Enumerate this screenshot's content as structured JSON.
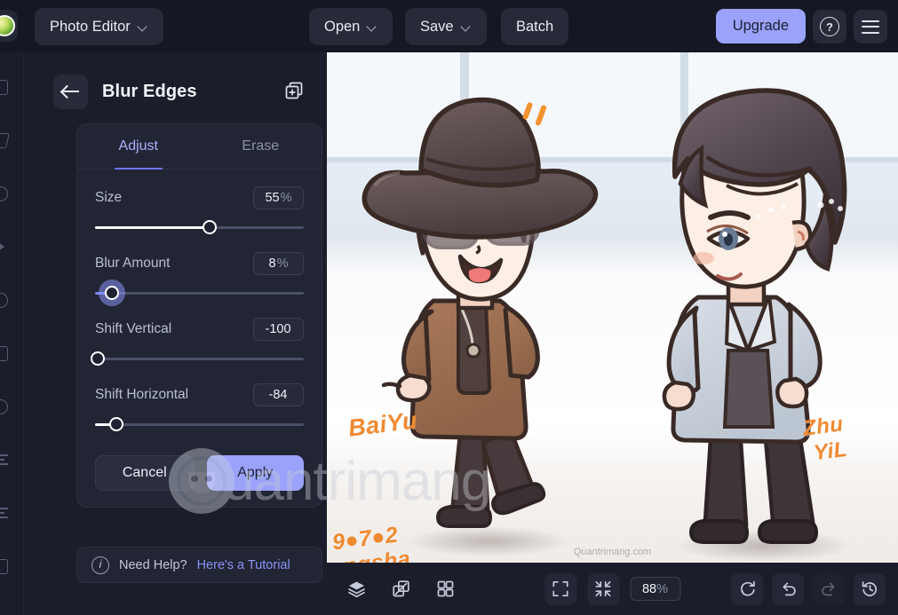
{
  "topbar": {
    "logo_icon": "app-logo",
    "app_name": "Photo Editor",
    "open_label": "Open",
    "save_label": "Save",
    "batch_label": "Batch",
    "upgrade_label": "Upgrade",
    "help_icon": "question-mark-icon",
    "menu_icon": "hamburger-menu-icon",
    "upgrade_color": "#9aa2fb"
  },
  "left_rail": {
    "items": [
      {
        "icon": "crop-icon"
      },
      {
        "icon": "magic-wand-icon"
      },
      {
        "icon": "shape-icon"
      },
      {
        "icon": "brush-icon"
      },
      {
        "icon": "blur-icon"
      },
      {
        "icon": "frame-icon"
      },
      {
        "icon": "sticker-icon"
      },
      {
        "icon": "text-icon"
      },
      {
        "icon": "adjust-icon"
      },
      {
        "icon": "effects-icon"
      }
    ]
  },
  "panel": {
    "back_icon": "arrow-left-icon",
    "title": "Blur Edges",
    "duplicate_icon": "add-to-collection-icon",
    "tabs": [
      {
        "label": "Adjust",
        "active": true
      },
      {
        "label": "Erase",
        "active": false
      }
    ],
    "controls": [
      {
        "label": "Size",
        "value": "55",
        "unit": "%",
        "percent": 55,
        "focused": false,
        "accent": false
      },
      {
        "label": "Blur Amount",
        "value": "8",
        "unit": "%",
        "percent": 8,
        "focused": true,
        "accent": true
      },
      {
        "label": "Shift Vertical",
        "value": "-100",
        "unit": "",
        "percent": 0,
        "focused": false,
        "accent": false
      },
      {
        "label": "Shift Horizontal",
        "value": "-84",
        "unit": "",
        "percent": 8,
        "focused": false,
        "accent": false
      }
    ],
    "cancel_label": "Cancel",
    "apply_label": "Apply",
    "help": {
      "icon": "info-icon",
      "prompt": "Need Help?",
      "link": "Here's a Tutorial"
    },
    "accent_color": "#6d78f0"
  },
  "canvas": {
    "annotations": {
      "name_left": "BaiYu",
      "date": "9●7●2",
      "city": "angsha",
      "name_right_1": "Zhu",
      "name_right_2": "YiL"
    },
    "watermark_text": "uantrimang",
    "watermark_logo": "panda-logo-icon",
    "subtitle": "Quantrimang.com"
  },
  "bottombar": {
    "left_icons": [
      {
        "icon": "layers-icon"
      },
      {
        "icon": "compare-split-icon"
      },
      {
        "icon": "grid-view-icon"
      }
    ],
    "mid_icons": [
      {
        "icon": "fit-to-screen-icon"
      },
      {
        "icon": "shrink-to-fit-icon"
      }
    ],
    "zoom_value": "88",
    "zoom_unit": "%",
    "right_icons": [
      {
        "icon": "reset-rotate-icon",
        "dim": false
      },
      {
        "icon": "undo-icon",
        "dim": false
      },
      {
        "icon": "redo-icon",
        "dim": true
      },
      {
        "icon": "history-icon",
        "dim": false
      }
    ]
  }
}
